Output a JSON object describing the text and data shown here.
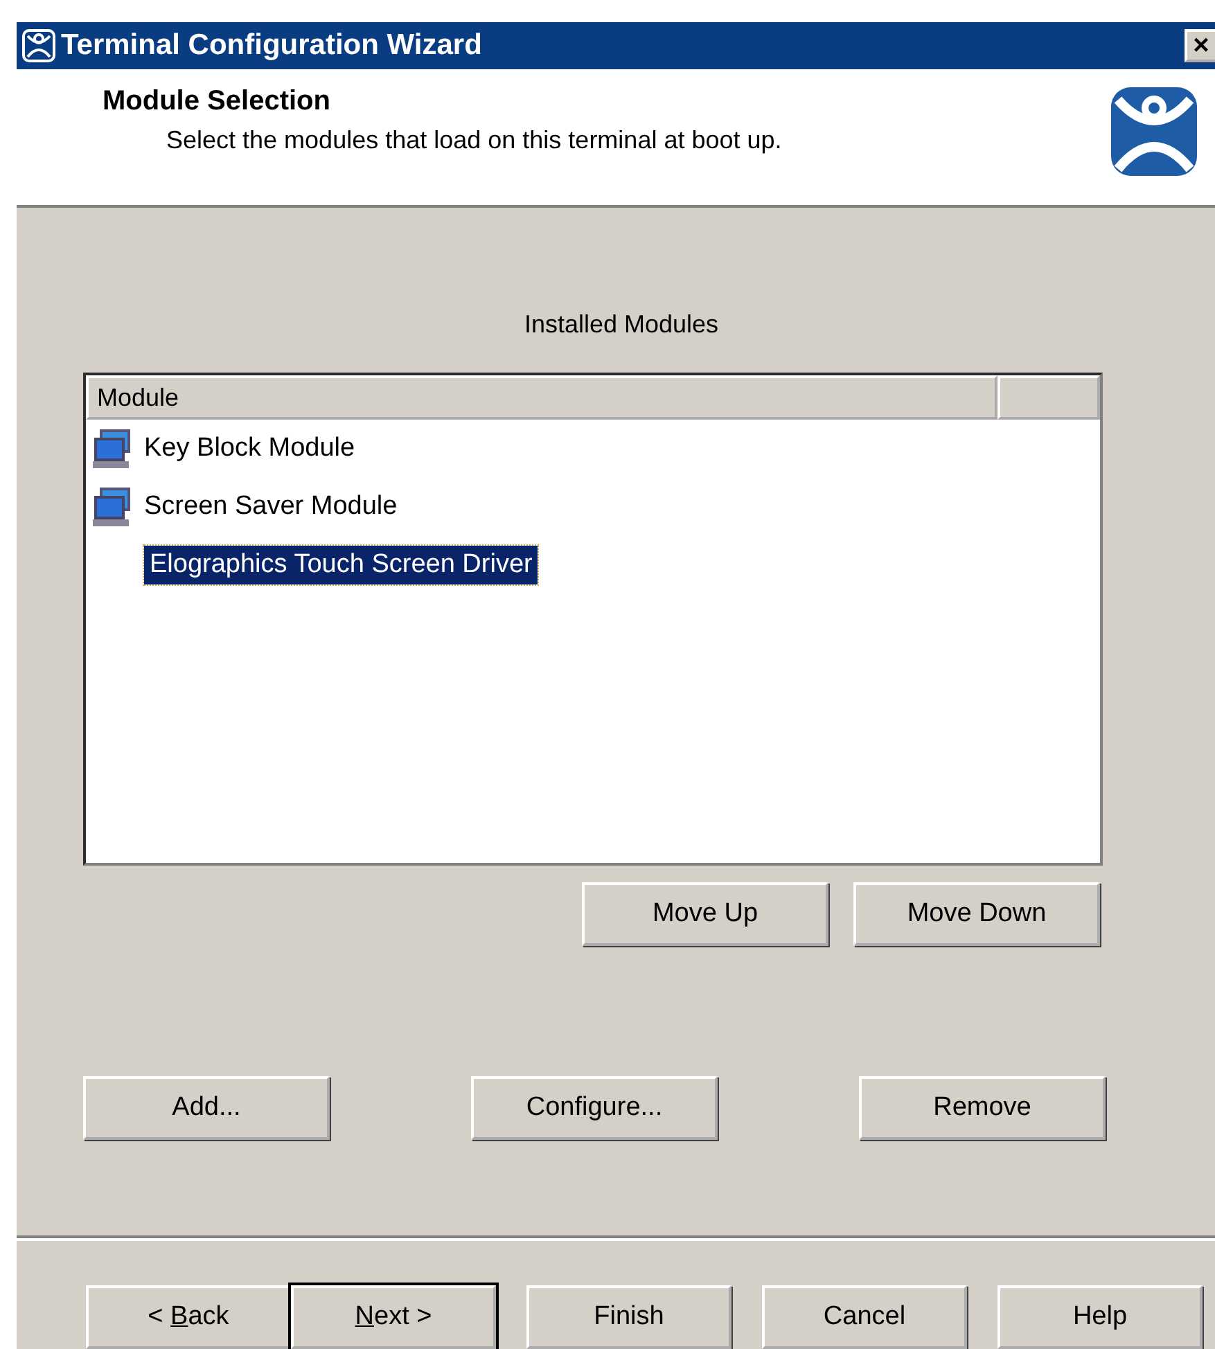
{
  "window": {
    "title": "Terminal Configuration Wizard",
    "close": "×"
  },
  "header": {
    "title": "Module Selection",
    "subtitle": "Select the modules that load on this terminal at boot up."
  },
  "list": {
    "label": "Installed Modules",
    "columns": [
      "Module"
    ],
    "rows": [
      {
        "name": "Key Block Module",
        "kind": "module",
        "selected": false
      },
      {
        "name": "Screen Saver Module",
        "kind": "module",
        "selected": false
      },
      {
        "name": "Elographics Touch Screen Driver",
        "kind": "plain",
        "selected": true
      }
    ]
  },
  "order_buttons": [
    "Move Up",
    "Move Down"
  ],
  "action_buttons": [
    "Add...",
    "Configure...",
    "Remove"
  ],
  "nav_buttons": [
    {
      "prefix": "< ",
      "key": "B",
      "rest": "ack",
      "default": false
    },
    {
      "key": "N",
      "rest": "ext >",
      "default": true
    },
    {
      "rest": "Finish",
      "default": false
    },
    {
      "rest": "Cancel",
      "default": false
    },
    {
      "rest": "Help",
      "default": false
    }
  ]
}
